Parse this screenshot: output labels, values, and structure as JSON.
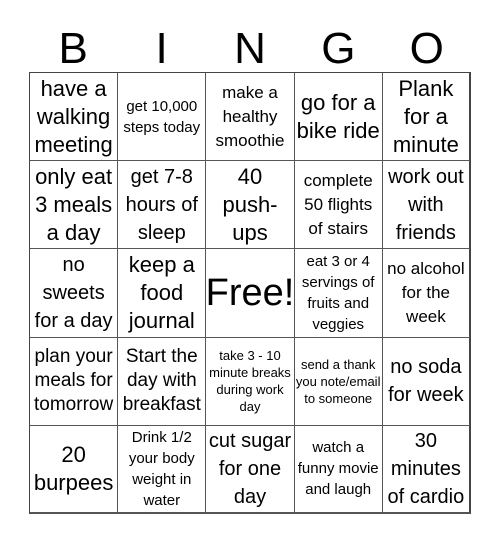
{
  "header": {
    "letters": [
      "B",
      "I",
      "N",
      "G",
      "O"
    ]
  },
  "cells": [
    {
      "text": "have a walking meeting",
      "size": "s-l"
    },
    {
      "text": "get 10,000 steps today",
      "size": "s-xs"
    },
    {
      "text": "make a healthy smoothie",
      "size": "s-s"
    },
    {
      "text": "go for a bike ride",
      "size": "s-l"
    },
    {
      "text": "Plank for a minute",
      "size": "s-l"
    },
    {
      "text": "only eat 3 meals a day",
      "size": "s-l"
    },
    {
      "text": "get 7-8 hours of sleep",
      "size": "s-m"
    },
    {
      "text": "40 push-ups",
      "size": "s-l"
    },
    {
      "text": "complete 50 flights of stairs",
      "size": "s-s"
    },
    {
      "text": "work out with friends",
      "size": "s-m"
    },
    {
      "text": "no sweets for a day",
      "size": "s-m"
    },
    {
      "text": "keep a food journal",
      "size": "s-l"
    },
    {
      "text": "Free!",
      "size": "s-xl"
    },
    {
      "text": "eat 3 or 4 servings of fruits and veggies",
      "size": "s-xs"
    },
    {
      "text": "no alcohol for the week",
      "size": "s-s"
    },
    {
      "text": "plan your meals for tomorrow",
      "size": "s-ms"
    },
    {
      "text": "Start the day with breakfast",
      "size": "s-ms"
    },
    {
      "text": "take 3 - 10 minute breaks during work day",
      "size": "s-xxs"
    },
    {
      "text": "send a thank you note/email to someone",
      "size": "s-xxs"
    },
    {
      "text": "no soda for week",
      "size": "s-m"
    },
    {
      "text": "20 burpees",
      "size": "s-l"
    },
    {
      "text": "Drink 1/2 your body weight in water",
      "size": "s-xs"
    },
    {
      "text": "cut sugar for one day",
      "size": "s-m"
    },
    {
      "text": "watch a funny movie and laugh",
      "size": "s-xs"
    },
    {
      "text": "30 minutes of cardio",
      "size": "s-m"
    }
  ]
}
